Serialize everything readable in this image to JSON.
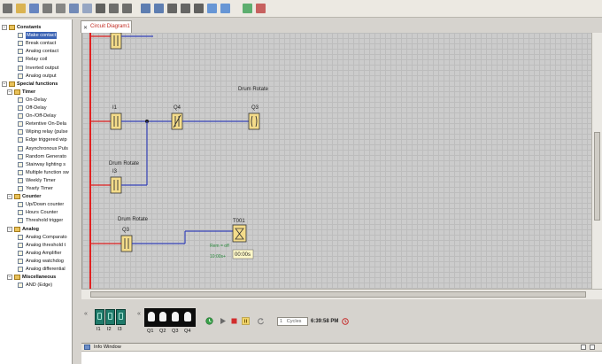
{
  "tab": {
    "label": "Circuit Diagram1"
  },
  "toolbar": {
    "icons": [
      "new-icon",
      "open-icon",
      "save-icon",
      "print-icon",
      "cut-icon",
      "copy-icon",
      "paste-icon",
      "delete-icon",
      "undo-icon",
      "redo-icon",
      "align-icon",
      "distribute-icon",
      "connector-icon",
      "split-icon",
      "select-icon",
      "zoom-in-icon",
      "zoom-out-icon",
      "simulate-icon",
      "help-icon"
    ]
  },
  "tree": {
    "items": [
      {
        "label": "Constants",
        "type": "category",
        "expanded": true
      },
      {
        "label": "Make contact",
        "type": "item",
        "selected": true
      },
      {
        "label": "Break contact",
        "type": "item"
      },
      {
        "label": "Analog contact",
        "type": "item"
      },
      {
        "label": "Relay coil",
        "type": "item"
      },
      {
        "label": "Inverted output",
        "type": "item"
      },
      {
        "label": "Analog output",
        "type": "item"
      },
      {
        "label": "Special functions",
        "type": "category",
        "expanded": true
      },
      {
        "label": "Timer",
        "type": "subcategory",
        "expanded": true
      },
      {
        "label": "On-Delay",
        "type": "item"
      },
      {
        "label": "Off-Delay",
        "type": "item"
      },
      {
        "label": "On-/Off-Delay",
        "type": "item"
      },
      {
        "label": "Retentive On-Dela",
        "type": "item"
      },
      {
        "label": "Wiping relay (pulse",
        "type": "item"
      },
      {
        "label": "Edge triggered wip",
        "type": "item"
      },
      {
        "label": "Asynchronous Puls",
        "type": "item"
      },
      {
        "label": "Random Generato",
        "type": "item"
      },
      {
        "label": "Stairway lighting s",
        "type": "item"
      },
      {
        "label": "Multiple function sw",
        "type": "item"
      },
      {
        "label": "Weekly Timer",
        "type": "item"
      },
      {
        "label": "Yearly Timer",
        "type": "item"
      },
      {
        "label": "Counter",
        "type": "subcategory",
        "expanded": true
      },
      {
        "label": "Up/Down counter",
        "type": "item"
      },
      {
        "label": "Hours Counter",
        "type": "item"
      },
      {
        "label": "Threshold trigger",
        "type": "item"
      },
      {
        "label": "Analog",
        "type": "subcategory",
        "expanded": true
      },
      {
        "label": "Analog Comparato",
        "type": "item"
      },
      {
        "label": "Analog threshold t",
        "type": "item"
      },
      {
        "label": "Analog Amplifier",
        "type": "item"
      },
      {
        "label": "Analog watchdog",
        "type": "item"
      },
      {
        "label": "Analog differential",
        "type": "item"
      },
      {
        "label": "Miscellaneous",
        "type": "subcategory",
        "expanded": true
      },
      {
        "label": "AND (Edge)",
        "type": "item"
      }
    ]
  },
  "diagram": {
    "rung2_comment": "Drum Rotate",
    "rung3_comment": "Drum Rotate",
    "rung4_comment": "Drum Rotate",
    "contact_i1": "I1",
    "contact_q4": "Q4",
    "coil_q3": "Q3",
    "contact_i3": "I3",
    "contact_q3": "Q3",
    "timer_label": "T001",
    "timer_rem": "Rem = off",
    "timer_preset": "10:00s+",
    "timer_value": "00:00s"
  },
  "sim": {
    "inputs": [
      "I1",
      "I2",
      "I3"
    ],
    "outputs": [
      "Q1",
      "Q2",
      "Q3",
      "Q4"
    ],
    "cycles_value": "1",
    "cycles_unit": "Cycles",
    "clock": "6:39:58 PM"
  },
  "info": {
    "title": "Info Window"
  },
  "colors": {
    "powerRail": "#e02020",
    "wire": "#3542b8",
    "contactFill": "#f4dc8a",
    "selectedTree": "#3b63b4"
  }
}
